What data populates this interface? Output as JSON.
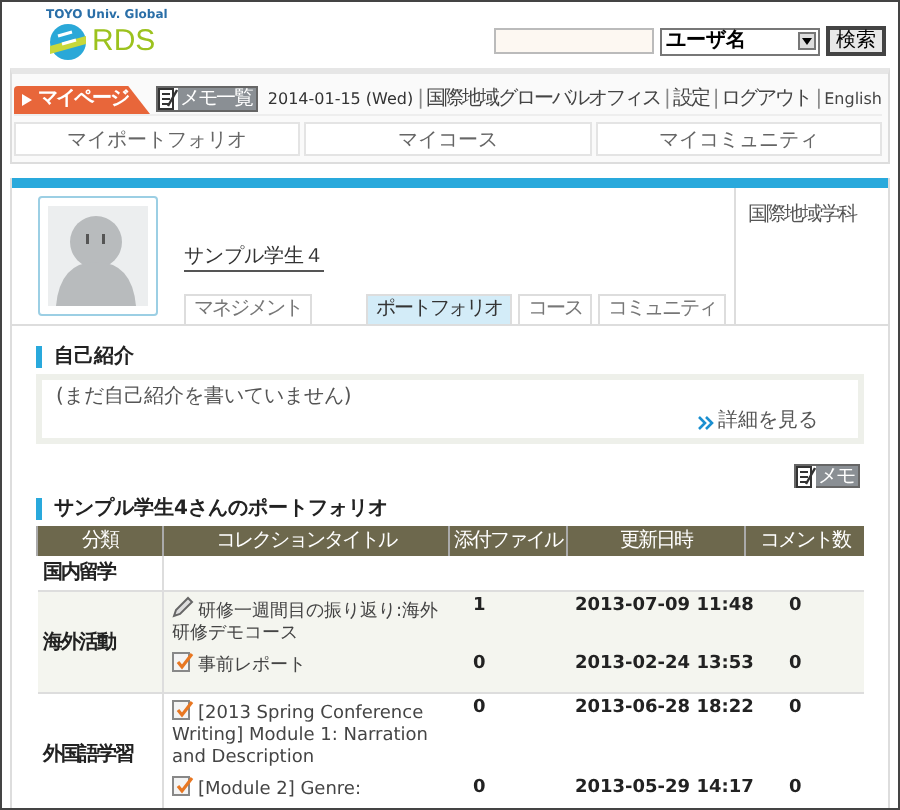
{
  "logo": {
    "tagline": "TOYO Univ. Global",
    "name": "RDS"
  },
  "search": {
    "select": "ユーザ名",
    "button": "検索"
  },
  "nav": {
    "tab": "マイページ",
    "memo": "メモ一覧",
    "date": "2014-01-15 (Wed)",
    "links": [
      "国際地域グローバルオフィス",
      "設定",
      "ログアウト",
      "English"
    ],
    "separators": [
      "|",
      "|",
      "|",
      "|"
    ]
  },
  "subnav": [
    "マイポートフォリオ",
    "マイコース",
    "マイコミュニティ"
  ],
  "profile": {
    "name": "サンプル学生４",
    "department": "国際地域学科",
    "tabs": [
      {
        "label": "マネジメント",
        "selected": false
      },
      {
        "label": "ポートフォリオ",
        "selected": true
      },
      {
        "label": "コース",
        "selected": false
      },
      {
        "label": "コミュニティ",
        "selected": false
      }
    ]
  },
  "intro": {
    "heading": "自己紹介",
    "text": "(まだ自己紹介を書いていません)",
    "link": "詳細を見る"
  },
  "portfolio": {
    "memo": "メモ",
    "heading": "サンプル学生4さんのポートフォリオ",
    "columns": [
      "分類",
      "コレクションタイトル",
      "添付ファイル",
      "更新日時",
      "コメント数"
    ],
    "rows": [
      {
        "category": "国内留学",
        "entries": []
      },
      {
        "category": "海外活動",
        "entries": [
          {
            "kind": "pencil",
            "title": "研修一週間目の振り返り:海外研修デモコース",
            "files": "1",
            "updated": "2013-07-09 11:48",
            "comments": "0"
          },
          {
            "kind": "report",
            "title": "事前レポート",
            "files": "0",
            "updated": "2013-02-24 13:53",
            "comments": "0"
          }
        ]
      },
      {
        "category": "外国語学習",
        "entries": [
          {
            "kind": "report",
            "title": "[2013 Spring Conference Writing] Module 1: Narration and Description",
            "files": "0",
            "updated": "2013-06-28 18:22",
            "comments": "0"
          },
          {
            "kind": "report",
            "title": "[Module 2] Genre:",
            "files": "0",
            "updated": "2013-05-29 14:17",
            "comments": "0"
          }
        ]
      }
    ]
  }
}
